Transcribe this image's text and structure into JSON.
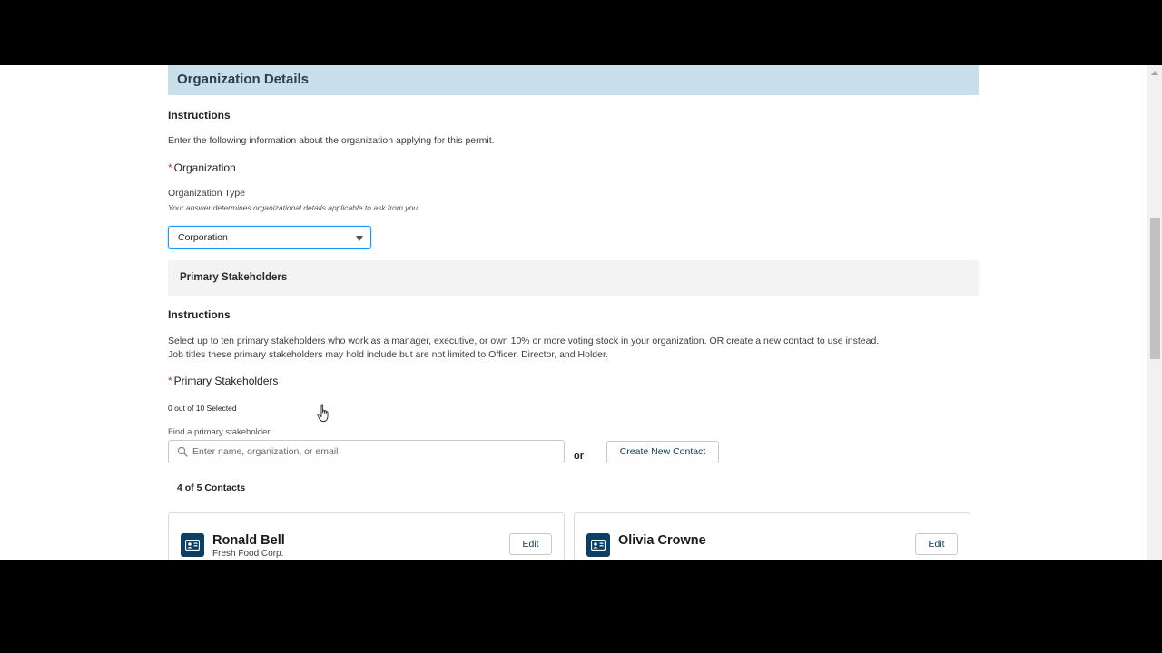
{
  "organization_details": {
    "title": "Organization Details",
    "instructions_heading": "Instructions",
    "instructions_text": "Enter the following information about the organization applying for this permit.",
    "organization_label": "Organization",
    "organization_type_label": "Organization Type",
    "organization_type_help": "Your answer determines organizational details applicable to ask from you.",
    "organization_type_value": "Corporation"
  },
  "primary_stakeholders": {
    "section_title": "Primary Stakeholders",
    "instructions_heading": "Instructions",
    "instructions_line1": "Select up to ten primary stakeholders who work as a manager, executive, or own 10% or more voting stock in your organization. OR create a new contact to use instead.",
    "instructions_line2": "Job titles these primary stakeholders may hold include but are not limited to Officer, Director, and Holder.",
    "field_label": "Primary Stakeholders",
    "selected_count": "0 out of 10 Selected",
    "find_label": "Find a primary stakeholder",
    "search_placeholder": "Enter name, organization, or email",
    "or_text": "or",
    "create_button": "Create New Contact",
    "contacts_count": "4 of 5 Contacts",
    "contacts": [
      {
        "name": "Ronald Bell",
        "organization": "Fresh Food Corp.",
        "edit_label": "Edit"
      },
      {
        "name": "Olivia Crowne",
        "organization": "",
        "edit_label": "Edit"
      }
    ]
  },
  "colors": {
    "header_bg": "#c9e0ec",
    "accent": "#1b96ff",
    "required": "#c23934",
    "contact_icon_bg": "#0d3e63"
  }
}
